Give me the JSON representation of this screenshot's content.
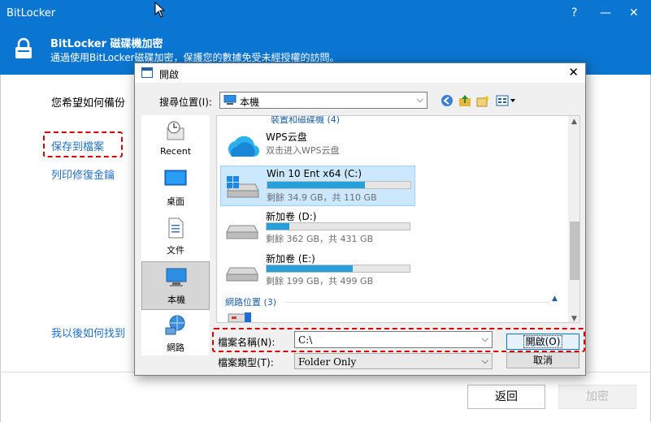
{
  "bitlocker": {
    "title": "BitLocker",
    "help": "?",
    "minimize": "—",
    "close": "✕",
    "header_title": "BitLocker 磁碟機加密",
    "header_subtitle": "通過使用BitLocker磁碟加密，保護您的數據免受未經授權的訪問。",
    "question": "您希望如何備份",
    "save_to_file": "保存到檔案",
    "print_key": "列印修復金鑰",
    "find_later": "我以後如何找到",
    "back_button": "返回",
    "encrypt_button": "加密"
  },
  "dialog": {
    "title": "開啟",
    "close": "✕",
    "look_in_label": "搜尋位置(I):",
    "look_in_value": "本機",
    "places": [
      {
        "label": "Recent"
      },
      {
        "label": "桌面"
      },
      {
        "label": "文件"
      },
      {
        "label": "本機"
      },
      {
        "label": "網路"
      }
    ],
    "list_clipped_label": "裝置和磁碟機 (4)",
    "items": [
      {
        "name": "WPS云盘",
        "sub": "双击进入WPS云盘"
      },
      {
        "name": "Win 10 Ent x64 (C:)",
        "sub": "剩餘 34.9 GB，共 110 GB",
        "used": 0.68
      },
      {
        "name": "新加卷 (D:)",
        "sub": "剩餘 362 GB，共 431 GB",
        "used": 0.16
      },
      {
        "name": "新加卷 (E:)",
        "sub": "剩餘 199 GB，共 499 GB",
        "used": 0.6
      }
    ],
    "network_header": "網路位置 (3)",
    "file_name_label": "檔案名稱(N):",
    "file_name_value": "C:\\",
    "file_type_label": "檔案類型(T):",
    "file_type_value": "Folder Only",
    "open_button": "開啟(O)",
    "cancel_button": "取消"
  },
  "colors": {
    "accent": "#0b76d1",
    "link": "#1f6fc5",
    "highlight": "#d60000",
    "progress": "#26a0da"
  }
}
